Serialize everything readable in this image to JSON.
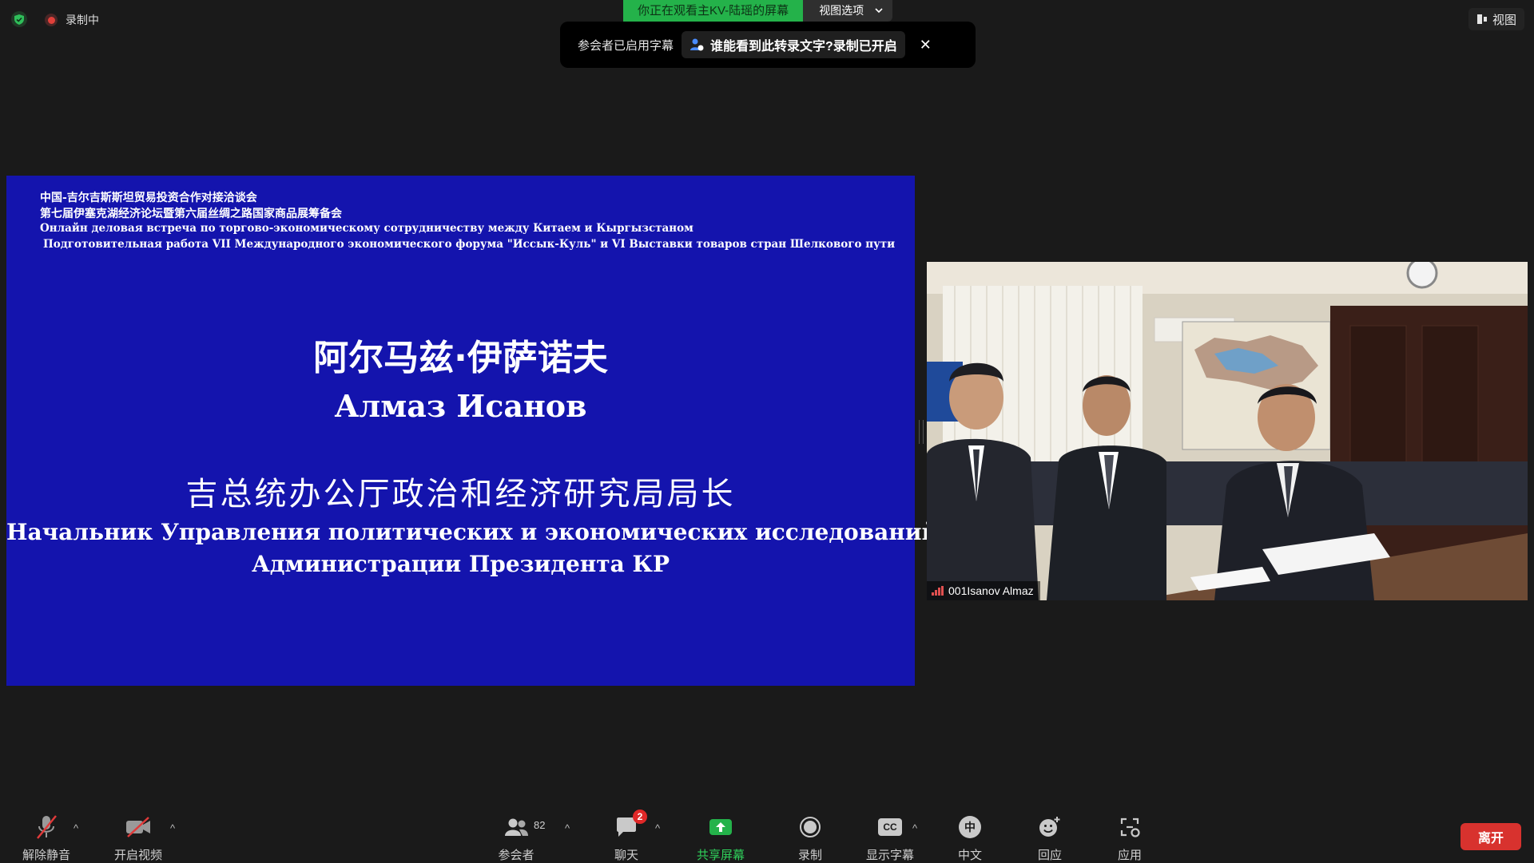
{
  "top": {
    "recording_label": "录制中",
    "share_banner": "你正在观看主KV-陆瑶的屏幕",
    "view_options_label": "视图选项",
    "view_button_label": "视图"
  },
  "caption_toast": {
    "message": "参会者已启用字幕",
    "link_text": "谁能看到此转录文字?录制已开启",
    "close_glyph": "✕"
  },
  "slide": {
    "header_lines": [
      "中国-吉尔吉斯斯坦贸易投资合作对接洽谈会",
      "第七届伊塞克湖经济论坛暨第六届丝绸之路国家商品展筹备会",
      "Онлайн деловая встреча по торгово-экономическому сотрудничеству между Китаем и Кыргызстаном",
      "Подготовительная работа VII Международного экономического форума \"Иссык-Куль\" и VI Выставки товаров стран Шелкового пути"
    ],
    "name_cn": "阿尔马兹·伊萨诺夫",
    "name_ru": "Алмаз Исанов",
    "title_cn": "吉总统办公厅政治和经济研究局局长",
    "title_ru_line1": "Начальник Управления политических  и экономических исследований",
    "title_ru_line2": "Администрации Президента КР"
  },
  "video": {
    "participant_name": "001Isanov Almaz",
    "signal_color": "#e05050"
  },
  "toolbar": {
    "unmute": "解除静音",
    "start_video": "开启视频",
    "participants": "参会者",
    "participants_count": "82",
    "chat": "聊天",
    "chat_badge": "2",
    "share_screen": "共享屏幕",
    "record": "录制",
    "captions": "显示字幕",
    "captions_icon_text": "CC",
    "language": "中文",
    "language_icon_text": "中",
    "reactions": "回应",
    "apps": "应用",
    "leave": "离开",
    "caret": "^"
  },
  "colors": {
    "slide_bg": "#1414ad",
    "share_green": "#24b24a",
    "leave_red": "#d8322e"
  }
}
